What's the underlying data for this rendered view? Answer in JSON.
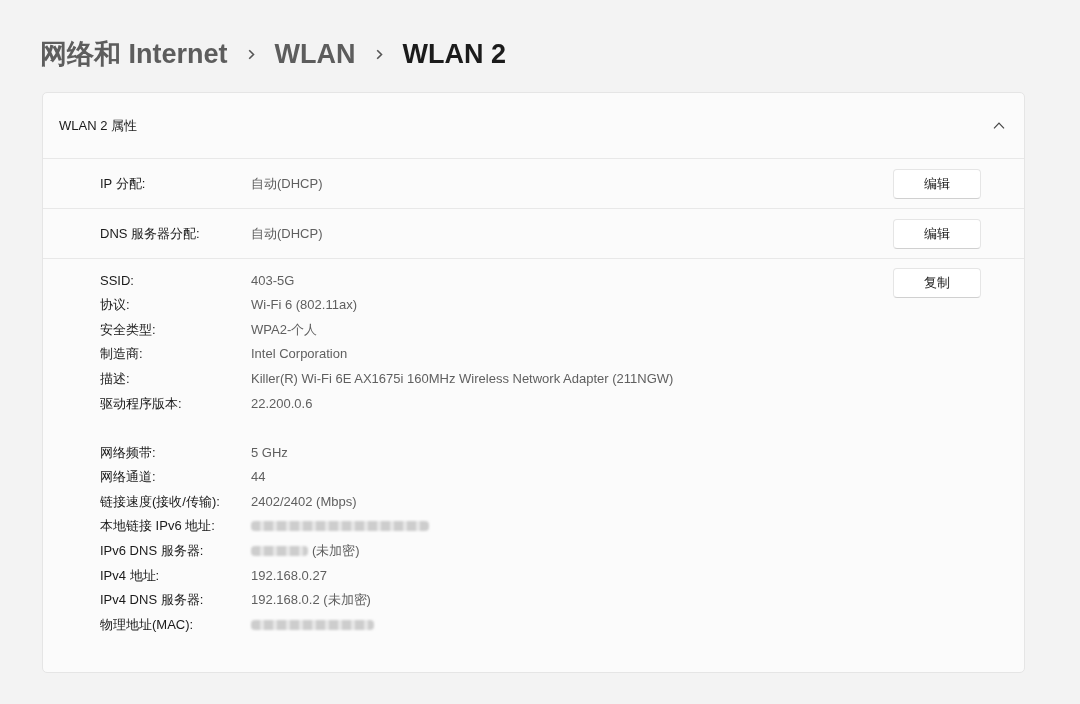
{
  "breadcrumb": [
    {
      "label": "网络和 Internet",
      "current": false
    },
    {
      "label": "WLAN",
      "current": false
    },
    {
      "label": "WLAN 2",
      "current": true
    }
  ],
  "properties": {
    "title": "WLAN 2 属性",
    "expanded": true,
    "settings": [
      {
        "label": "IP 分配:",
        "value": "自动(DHCP)",
        "button": "编辑"
      },
      {
        "label": "DNS 服务器分配:",
        "value": "自动(DHCP)",
        "button": "编辑"
      }
    ],
    "details": {
      "button": "复制",
      "groups": [
        [
          {
            "label": "SSID:",
            "value": "403-5G"
          },
          {
            "label": "协议:",
            "value": "Wi-Fi 6 (802.11ax)"
          },
          {
            "label": "安全类型:",
            "value": "WPA2-个人"
          },
          {
            "label": "制造商:",
            "value": "Intel Corporation"
          },
          {
            "label": "描述:",
            "value": "Killer(R) Wi-Fi 6E AX1675i 160MHz Wireless Network Adapter (211NGW)"
          },
          {
            "label": "驱动程序版本:",
            "value": "22.200.0.6"
          }
        ],
        [
          {
            "label": "网络频带:",
            "value": "5 GHz"
          },
          {
            "label": "网络通道:",
            "value": "44"
          },
          {
            "label": "链接速度(接收/传输):",
            "value": "2402/2402 (Mbps)"
          },
          {
            "label": "本地链接 IPv6 地址:",
            "redacted": true
          },
          {
            "label": "IPv6 DNS 服务器:",
            "redacted": true,
            "value": "(未加密)"
          },
          {
            "label": "IPv4 地址:",
            "value": "192.168.0.27"
          },
          {
            "label": "IPv4 DNS 服务器:",
            "value": "192.168.0.2 (未加密)"
          },
          {
            "label": "物理地址(MAC):",
            "redacted": true
          }
        ]
      ]
    }
  }
}
